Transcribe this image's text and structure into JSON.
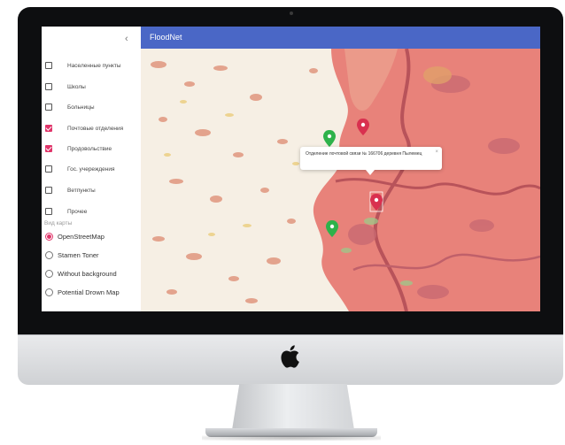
{
  "app": {
    "title": "FloodNet",
    "collapse_glyph": "‹"
  },
  "layers": [
    {
      "label": "Населенные пункты",
      "checked": false
    },
    {
      "label": "Школы",
      "checked": false
    },
    {
      "label": "Больницы",
      "checked": false
    },
    {
      "label": "Почтовые отделения",
      "checked": true
    },
    {
      "label": "Продовольствие",
      "checked": true
    },
    {
      "label": "Гос. учереждения",
      "checked": false
    },
    {
      "label": "Ветпункты",
      "checked": false
    },
    {
      "label": "Прочее",
      "checked": false
    }
  ],
  "map_type": {
    "title": "Вид карты",
    "options": [
      {
        "label": "OpenStreetMap",
        "selected": true
      },
      {
        "label": "Stamen Toner",
        "selected": false
      },
      {
        "label": "Without background",
        "selected": false
      },
      {
        "label": "Potential Drown Map",
        "selected": false
      }
    ]
  },
  "popup": {
    "text": "Отделение почтовой связи № 166706 деревня Пылемец",
    "close_glyph": "×"
  },
  "markers": [
    {
      "color": "#2eb24a",
      "icon": "map-pin-icon"
    },
    {
      "color": "#d9304f",
      "icon": "map-pin-icon"
    },
    {
      "color": "#d9304f",
      "icon": "map-pin-icon"
    },
    {
      "color": "#2eb24a",
      "icon": "map-pin-icon"
    }
  ],
  "colors": {
    "accent": "#e0356a",
    "appbar": "#4a67c6",
    "flood": "#e8827a",
    "map_base": "#f6efe4"
  }
}
